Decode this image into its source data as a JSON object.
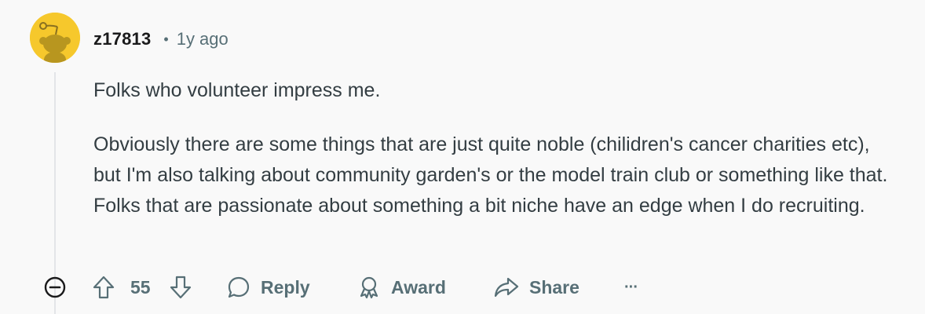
{
  "comment": {
    "author": "z17813",
    "separator": "•",
    "time_ago": "1y ago",
    "paragraphs": [
      "Folks who volunteer impress me.",
      "Obviously there are some things that are just quite noble (chilidren's cancer charities etc), but I'm also talking about community garden's or the model train club or something like that. Folks that are passionate about something a bit niche have an edge when I do recruiting."
    ],
    "avatar_color": "#f6c82c"
  },
  "actions": {
    "score": "55",
    "reply_label": "Reply",
    "award_label": "Award",
    "share_label": "Share",
    "more_label": "···"
  },
  "icons": {
    "collapse": "minus-circle-icon",
    "upvote": "arrow-up-icon",
    "downvote": "arrow-down-icon",
    "reply": "speech-bubble-icon",
    "award": "award-ribbon-icon",
    "share": "share-arrow-icon"
  }
}
